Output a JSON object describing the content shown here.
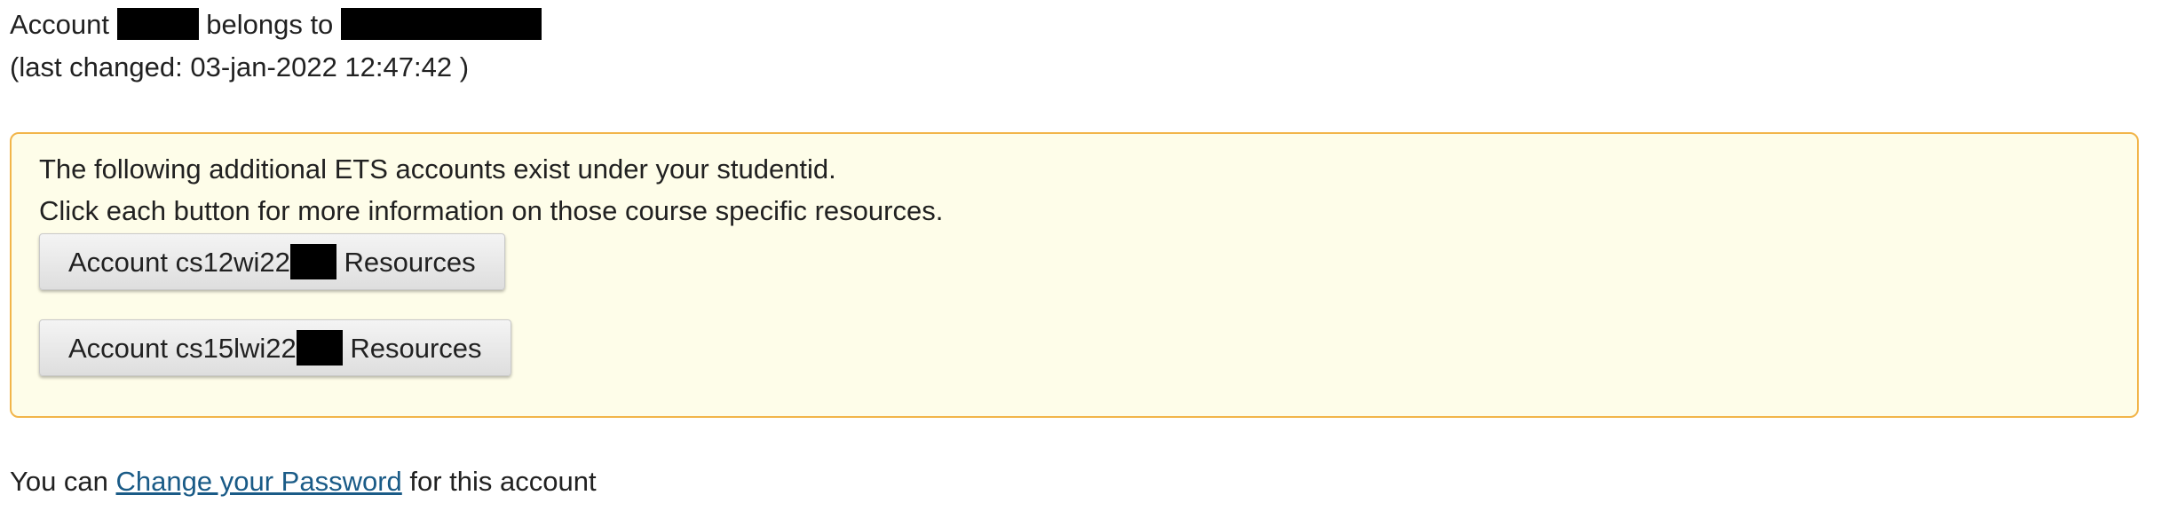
{
  "header": {
    "account_prefix": "Account ",
    "belongs_text": " belongs to ",
    "last_changed": "(last changed: 03-jan-2022 12:47:42 )"
  },
  "info_box": {
    "line1": "The following additional ETS accounts exist under your studentid.",
    "line2": "Click each button for more information on those course specific resources.",
    "buttons": [
      {
        "prefix": "Account cs12wi22",
        "suffix": " Resources"
      },
      {
        "prefix": "Account cs15lwi22",
        "suffix": " Resources"
      }
    ]
  },
  "footer": {
    "prefix": "You can ",
    "link": "Change your Password",
    "suffix": " for this account"
  },
  "colors": {
    "info_background": "#fefde9",
    "info_border": "#f2b54a",
    "link": "#1a5b87",
    "redaction": "#000000"
  }
}
